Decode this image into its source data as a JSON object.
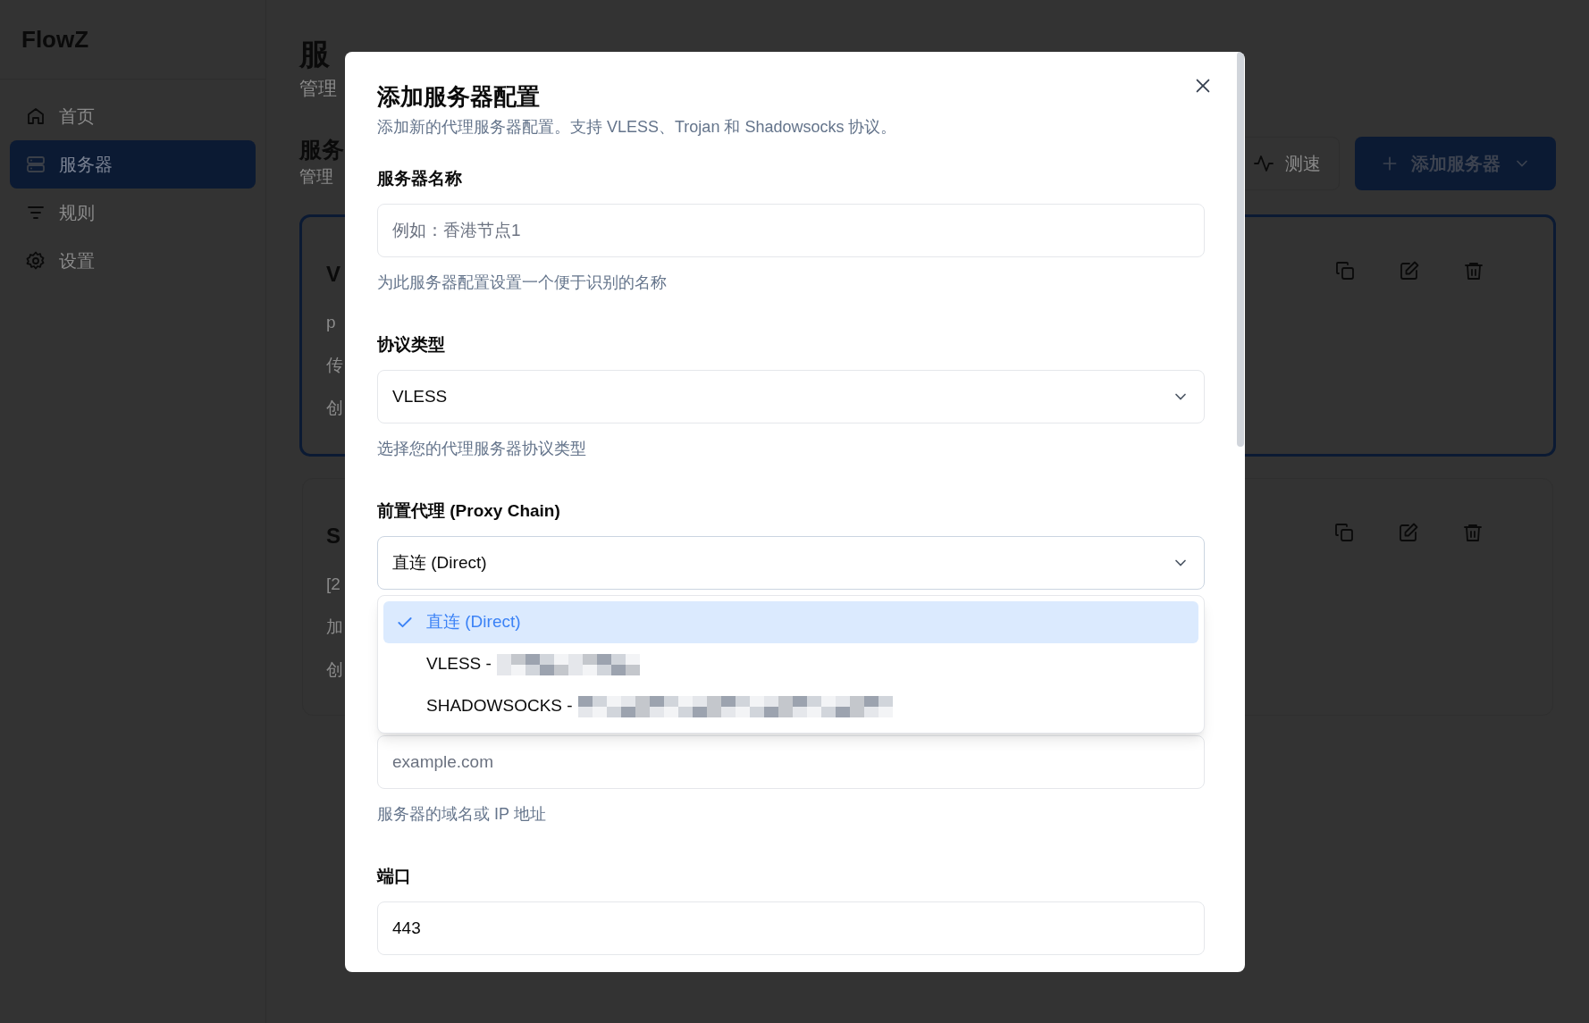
{
  "sidebar": {
    "logo": "FlowZ",
    "items": [
      {
        "label": "首页",
        "selected": false
      },
      {
        "label": "服务器",
        "selected": true
      },
      {
        "label": "规则",
        "selected": false
      },
      {
        "label": "设置",
        "selected": false
      }
    ]
  },
  "page": {
    "title": "服",
    "subtitle": "管理",
    "section_title": "服务",
    "section_subtitle": "管理",
    "speed_test_button": "测速",
    "add_button": "添加服务器",
    "cards": [
      {
        "selected": true,
        "lines": [
          "V",
          "p",
          "传",
          "创"
        ]
      },
      {
        "selected": false,
        "lines": [
          "S",
          "[2",
          "加",
          "创"
        ]
      }
    ]
  },
  "dialog": {
    "title": "添加服务器配置",
    "description": "添加新的代理服务器配置。支持 VLESS、Trojan 和 Shadowsocks 协议。",
    "fields": [
      {
        "kind": "input",
        "label": "服务器名称",
        "placeholder": "例如：香港节点1",
        "help": "为此服务器配置设置一个便于识别的名称"
      },
      {
        "kind": "select",
        "label": "协议类型",
        "value": "VLESS",
        "help": "选择您的代理服务器协议类型"
      },
      {
        "kind": "select",
        "label": "前置代理 (Proxy Chain)",
        "value": "直连 (Direct)",
        "expanded": true,
        "options": [
          {
            "label": "直连 (Direct)",
            "selected": true,
            "redacted": false
          },
          {
            "label": "VLESS -",
            "selected": false,
            "redacted": true
          },
          {
            "label": "SHADOWSOCKS -",
            "selected": false,
            "redacted": true
          }
        ]
      },
      {
        "kind": "input",
        "placeholder": "example.com",
        "help": "服务器的域名或 IP 地址"
      },
      {
        "kind": "input",
        "label": "端口",
        "value": "443"
      }
    ]
  }
}
